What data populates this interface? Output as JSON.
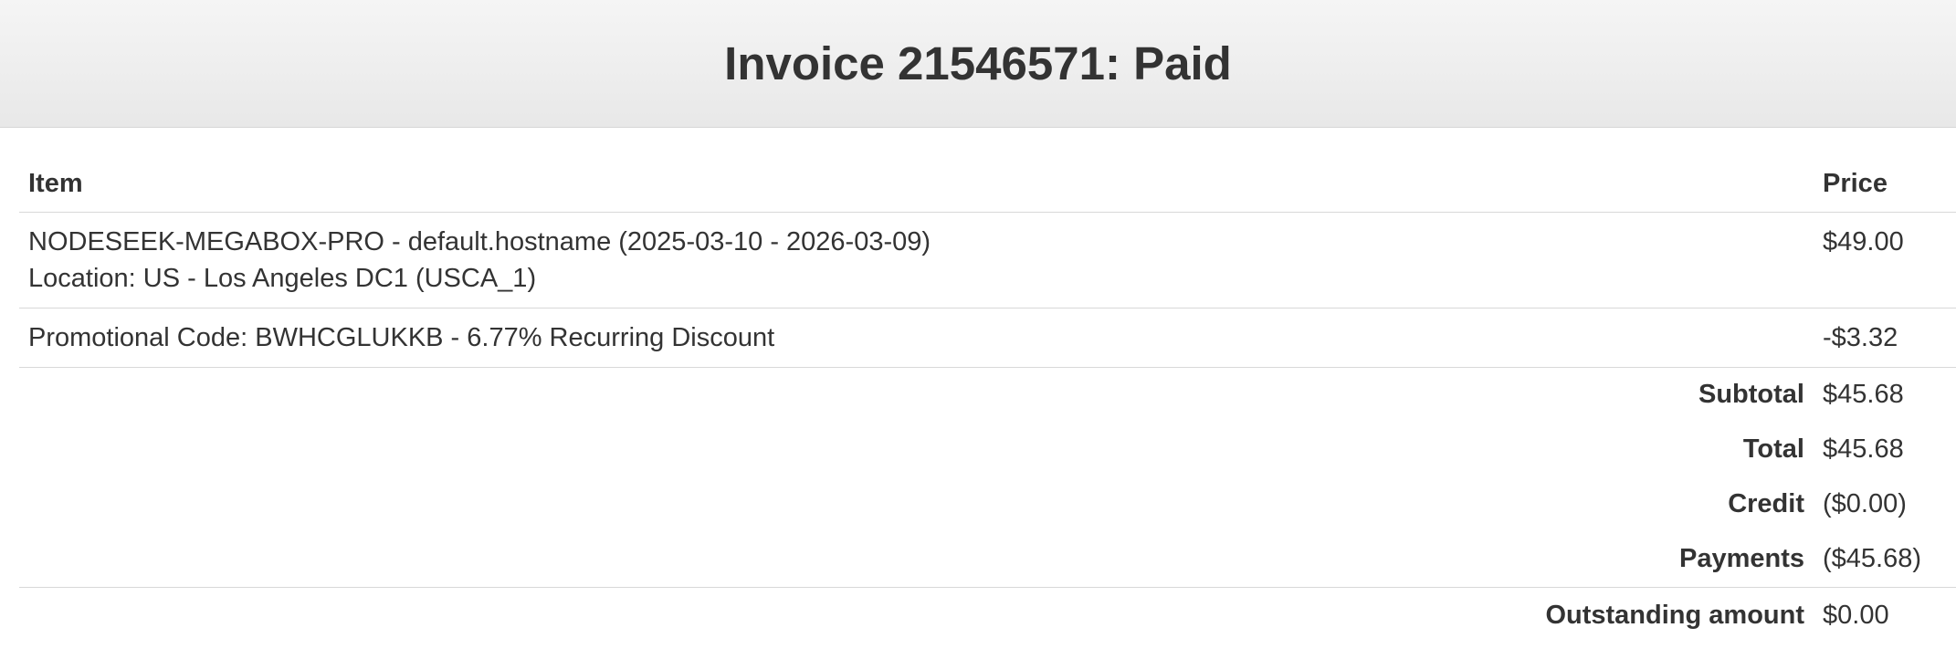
{
  "invoice": {
    "title": "Invoice 21546571: Paid"
  },
  "table": {
    "columns": {
      "item": "Item",
      "price": "Price"
    },
    "items": [
      {
        "line1": "NODESEEK-MEGABOX-PRO - default.hostname (2025-03-10 - 2026-03-09)",
        "line2": "Location: US - Los Angeles DC1 (USCA_1)",
        "price": "$49.00"
      },
      {
        "line1": "Promotional Code: BWHCGLUKKB - 6.77% Recurring Discount",
        "line2": "",
        "price": "-$3.32"
      }
    ],
    "summary": [
      {
        "label": "Subtotal",
        "value": "$45.68"
      },
      {
        "label": "Total",
        "value": "$45.68"
      },
      {
        "label": "Credit",
        "value": "($0.00)"
      },
      {
        "label": "Payments",
        "value": "($45.68)"
      },
      {
        "label": "Outstanding amount",
        "value": "$0.00"
      }
    ]
  }
}
